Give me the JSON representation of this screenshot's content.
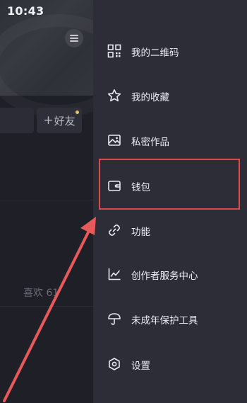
{
  "status_bar": {
    "time": "10:43"
  },
  "profile": {
    "add_friend_label": "好友",
    "likes_tab_label": "喜欢 61"
  },
  "drawer": {
    "items": [
      {
        "label": "我的二维码",
        "icon": "qr-code-icon"
      },
      {
        "label": "我的收藏",
        "icon": "star-icon"
      },
      {
        "label": "私密作品",
        "icon": "private-image-icon"
      },
      {
        "label": "钱包",
        "icon": "wallet-icon"
      },
      {
        "label": "功能",
        "icon": "link-icon"
      },
      {
        "label": "创作者服务中心",
        "icon": "chart-icon"
      },
      {
        "label": "未成年保护工具",
        "icon": "umbrella-icon"
      },
      {
        "label": "设置",
        "icon": "settings-icon"
      }
    ]
  },
  "annotation": {
    "highlight_color": "#e04848",
    "arrow_color": "#e85a5a"
  }
}
